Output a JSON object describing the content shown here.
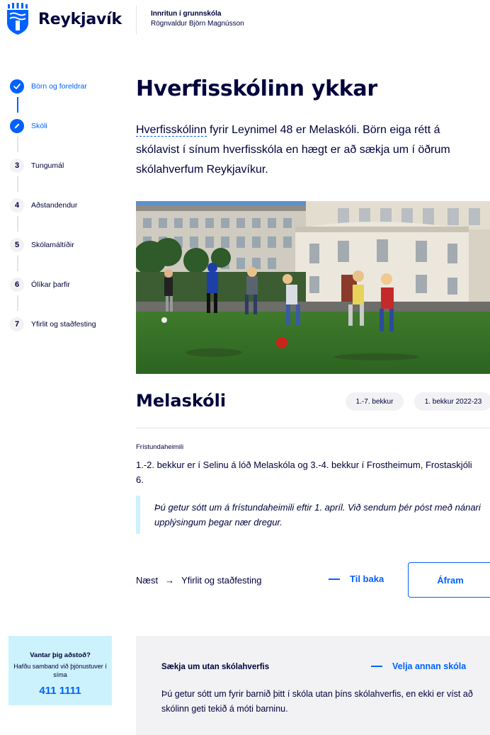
{
  "header": {
    "brand": "Reykjavík",
    "title": "Innritun í grunnskóla",
    "user": "Rögnvaldur Björn Magnússon"
  },
  "stepper": {
    "steps": [
      {
        "number": "",
        "label": "Börn og foreldrar",
        "state": "done"
      },
      {
        "number": "",
        "label": "Skóli",
        "state": "current"
      },
      {
        "number": "3",
        "label": "Tungumál",
        "state": "todo"
      },
      {
        "number": "4",
        "label": "Aðstandendur",
        "state": "todo"
      },
      {
        "number": "5",
        "label": "Skólamáltíðir",
        "state": "todo"
      },
      {
        "number": "6",
        "label": "Ólíkar þarfir",
        "state": "todo"
      },
      {
        "number": "7",
        "label": "Yfirlit og staðfesting",
        "state": "todo"
      }
    ]
  },
  "main": {
    "title": "Hverfisskólinn ykkar",
    "intro_link": "Hverfisskólinn",
    "intro_rest": " fyrir Leynimel 48 er Melaskóli. Börn eiga rétt á skólavist í sínum hverfisskóla en hægt er að sækja um í öðrum skólahverfum Reykjavíkur.",
    "school": {
      "name": "Melaskóli",
      "tag_grades": "1.-7. bekkur",
      "tag_year": "1. bekkur 2022-23"
    },
    "afterschool": {
      "label": "Frístundaheimili",
      "text": "1.-2. bekkur er í Selinu á lóð Melaskóla og 3.-4. bekkur í Frostheimum, Frostaskjóli 6."
    },
    "notice": "Þú getur sótt um á frístundaheimili eftir 1. apríl. Við sendum þér póst með nánari upplýsingum þegar nær dregur.",
    "nav": {
      "next_label": "Næst",
      "next_arrow": "→",
      "next_step": "Yfirlit og staðfesting",
      "back": "Til baka",
      "forward": "Áfram"
    }
  },
  "help": {
    "title": "Vantar þig aðstoð?",
    "text": "Hafðu samband við þjónustuver í síma",
    "phone": "411 1111"
  },
  "other_school": {
    "title": "Sækja um utan skólahverfis",
    "link": "Velja annan skóla",
    "text": "Þú getur sótt um fyrir barnið þitt í skóla utan þíns skólahverfis, en ekki er víst að skólinn geti tekið á móti barninu."
  },
  "colors": {
    "primary": "#0061ff",
    "text": "#00003c",
    "info_bg": "#ccf2fd",
    "muted_bg": "#f2f2f5"
  }
}
